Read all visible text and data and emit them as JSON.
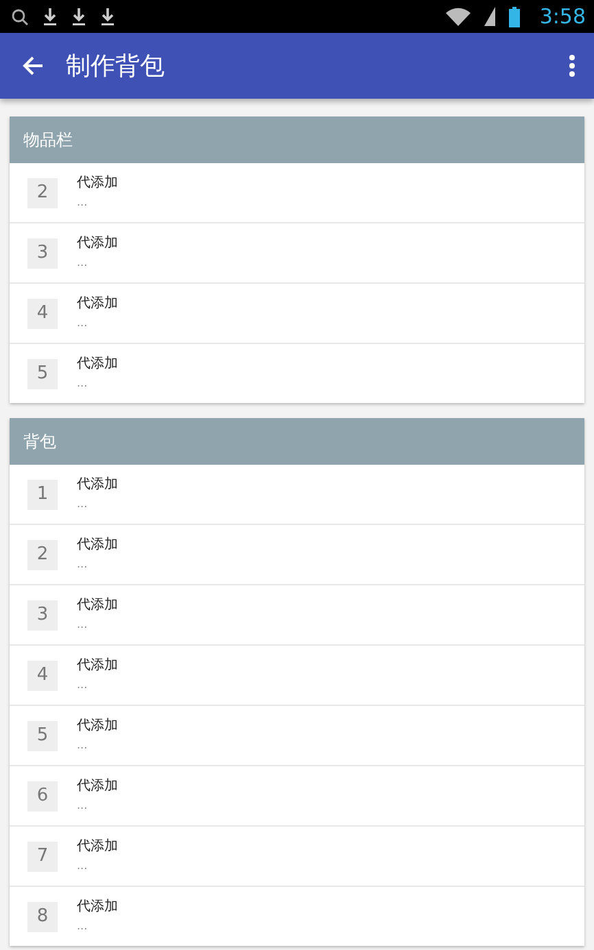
{
  "status_bar": {
    "time": "3:58"
  },
  "app_bar": {
    "title": "制作背包"
  },
  "sections": [
    {
      "title": "物品栏",
      "items": [
        {
          "number": "2",
          "name": "代添加",
          "detail": "..."
        },
        {
          "number": "3",
          "name": "代添加",
          "detail": "..."
        },
        {
          "number": "4",
          "name": "代添加",
          "detail": "..."
        },
        {
          "number": "5",
          "name": "代添加",
          "detail": "..."
        }
      ]
    },
    {
      "title": "背包",
      "items": [
        {
          "number": "1",
          "name": "代添加",
          "detail": "..."
        },
        {
          "number": "2",
          "name": "代添加",
          "detail": "..."
        },
        {
          "number": "3",
          "name": "代添加",
          "detail": "..."
        },
        {
          "number": "4",
          "name": "代添加",
          "detail": "..."
        },
        {
          "number": "5",
          "name": "代添加",
          "detail": "..."
        },
        {
          "number": "6",
          "name": "代添加",
          "detail": "..."
        },
        {
          "number": "7",
          "name": "代添加",
          "detail": "..."
        },
        {
          "number": "8",
          "name": "代添加",
          "detail": "..."
        }
      ]
    }
  ]
}
